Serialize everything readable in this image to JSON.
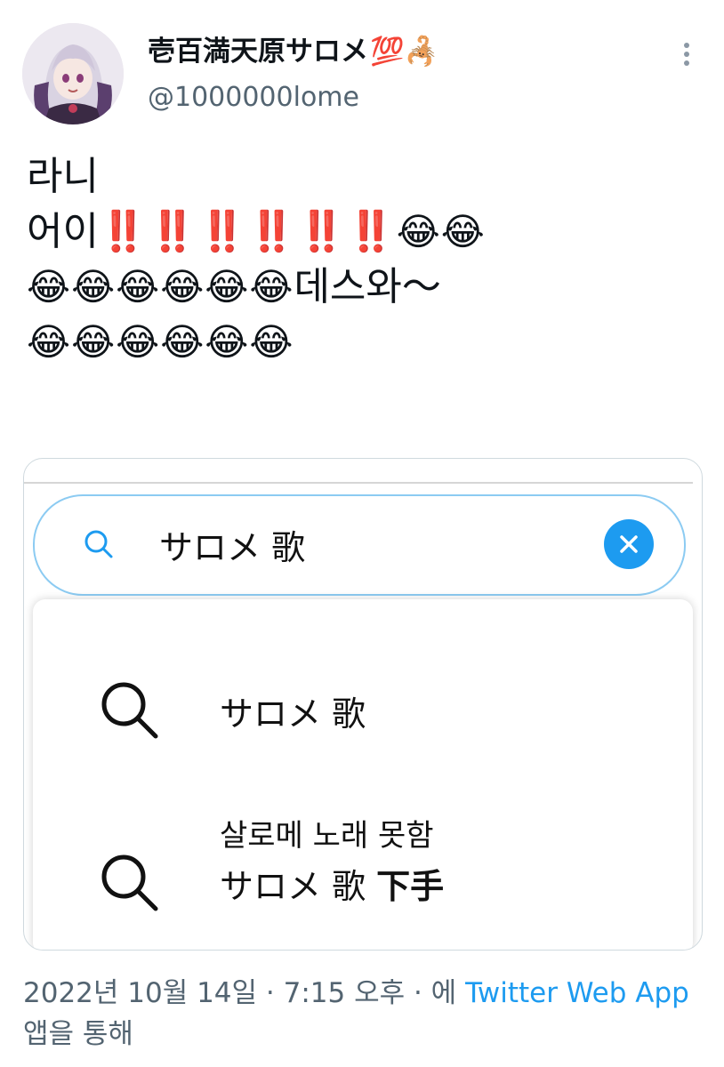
{
  "header": {
    "display_name": "壱百満天原サロメ",
    "display_name_suffix": "💯🦂",
    "handle": "@1000000lome",
    "avatar_icon": "avatar-anime-girl",
    "more_icon": "more-vertical-icon"
  },
  "tweet": {
    "line1": "라니",
    "line2_text": "어이",
    "line2_bangs": "‼️‼️‼️‼️‼️‼️",
    "line2_emoji": "😂😂",
    "line3_emoji": "😂😂😂😂😂😂",
    "line3_text": "데스와～",
    "line4_emoji": "😂😂😂😂😂😂"
  },
  "screenshot": {
    "search_value": "サロメ 歌",
    "search_icon": "search-icon",
    "clear_icon": "clear-icon",
    "suggestions": [
      {
        "text": "サロメ 歌"
      },
      {
        "translation": "살로메 노래 못함",
        "text_plain": "サロメ 歌 ",
        "text_bold": "下手"
      }
    ]
  },
  "footer": {
    "date_time": "2022년 10월 14일 · 7:15 오후 · 에 ",
    "source_link": "Twitter Web App",
    "via": "앱을 통해"
  },
  "colors": {
    "link": "#1d9bf0",
    "muted": "#536471",
    "clear_button": "#1d9bf0"
  }
}
